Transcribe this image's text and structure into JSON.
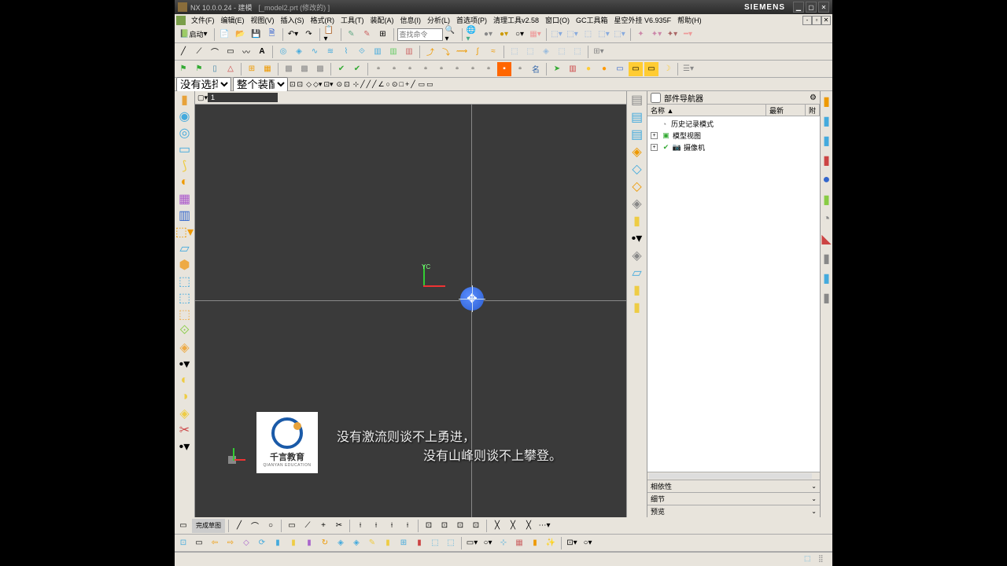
{
  "title": {
    "app": "NX 10.0.0.24 - 建模",
    "doc": "[_model2.prt (修改的) ]",
    "brand": "SIEMENS"
  },
  "menu": {
    "items": [
      "文件(F)",
      "编辑(E)",
      "视图(V)",
      "插入(S)",
      "格式(R)",
      "工具(T)",
      "装配(A)",
      "信息(I)",
      "分析(L)",
      "首选项(P)",
      "清理工具v2.58",
      "窗口(O)",
      "GC工具箱",
      "星空外挂 V6.935F",
      "帮助(H)"
    ]
  },
  "toolbar1": {
    "start": "启动",
    "search_ph": "查找命令"
  },
  "filter": {
    "sel_filter": "没有选择过滤器",
    "assembly": "整个装配"
  },
  "viewport": {
    "tab_label": "1",
    "y_axis": "YC"
  },
  "watermark": {
    "text": "千言教育",
    "sub": "QIANYAN EDUCATION"
  },
  "subtitles": {
    "line1": "没有激流则谈不上勇进，",
    "line2": "没有山峰则谈不上攀登。"
  },
  "navigator": {
    "title": "部件导航器",
    "cols": {
      "name": "名称 ▲",
      "latest": "最新",
      "attr": "附"
    },
    "nodes": {
      "history": "历史记录模式",
      "model_view": "模型视图",
      "camera": "摄像机"
    },
    "sections": {
      "depend": "相依性",
      "detail": "细节",
      "preview": "预览"
    }
  },
  "colors": {
    "accent": "#2a5dcf",
    "bg_viewport": "#3a3a3a",
    "axis_x": "#e33",
    "axis_y": "#3c3"
  }
}
